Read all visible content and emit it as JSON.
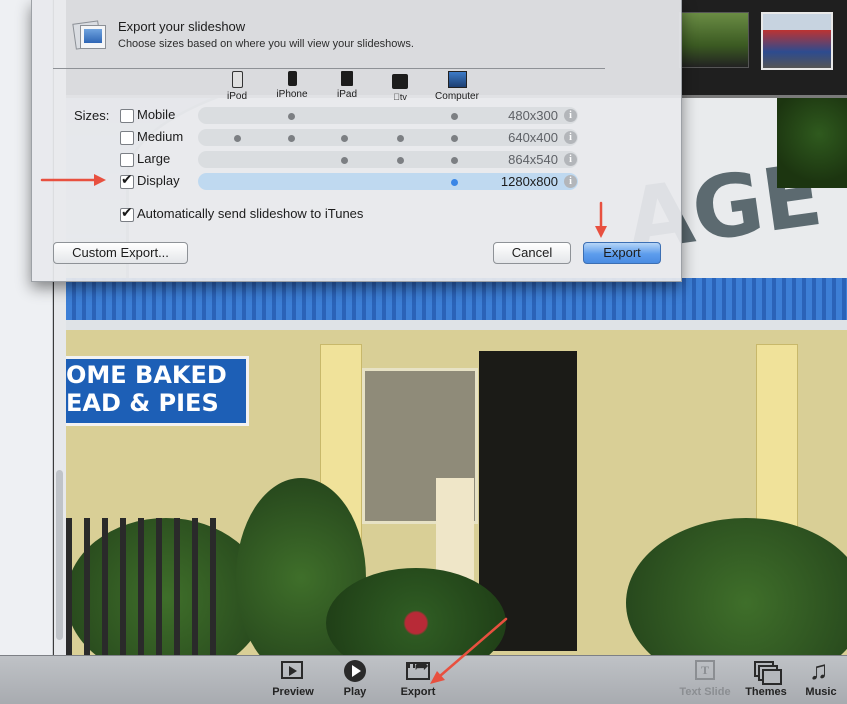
{
  "dialog": {
    "title": "Export your slideshow",
    "subtitle": "Choose sizes based on where you will view your slideshows.",
    "devices": [
      {
        "label": "iPod",
        "icon": "ipod-icon"
      },
      {
        "label": "iPhone",
        "icon": "iphone-icon"
      },
      {
        "label": "iPad",
        "icon": "ipad-icon"
      },
      {
        "label": "tv",
        "icon": "apple-tv-icon"
      },
      {
        "label": "Computer",
        "icon": "computer-icon"
      }
    ],
    "sizes_label": "Sizes:",
    "sizes": [
      {
        "label": "Mobile",
        "resolution": "480x300",
        "checked": false
      },
      {
        "label": "Medium",
        "resolution": "640x400",
        "checked": false
      },
      {
        "label": "Large",
        "resolution": "864x540",
        "checked": false
      },
      {
        "label": "Display",
        "resolution": "1280x800",
        "checked": true
      }
    ],
    "auto_send_label": "Automatically send slideshow to iTunes",
    "auto_send_checked": true,
    "buttons": {
      "custom_export": "Custom Export...",
      "cancel": "Cancel",
      "export": "Export"
    }
  },
  "photo": {
    "shop_sign_line1": "OME BAKED",
    "shop_sign_line2": "EAD & PIES",
    "arch_sign": "AGE"
  },
  "toolbar": {
    "preview": "Preview",
    "play": "Play",
    "export": "Export",
    "text_slide": "Text Slide",
    "themes": "Themes",
    "music": "Music"
  },
  "colors": {
    "annotation_arrow": "#e8503f",
    "default_button": "#5d9ded",
    "selected_row": "#b7d6f0"
  }
}
